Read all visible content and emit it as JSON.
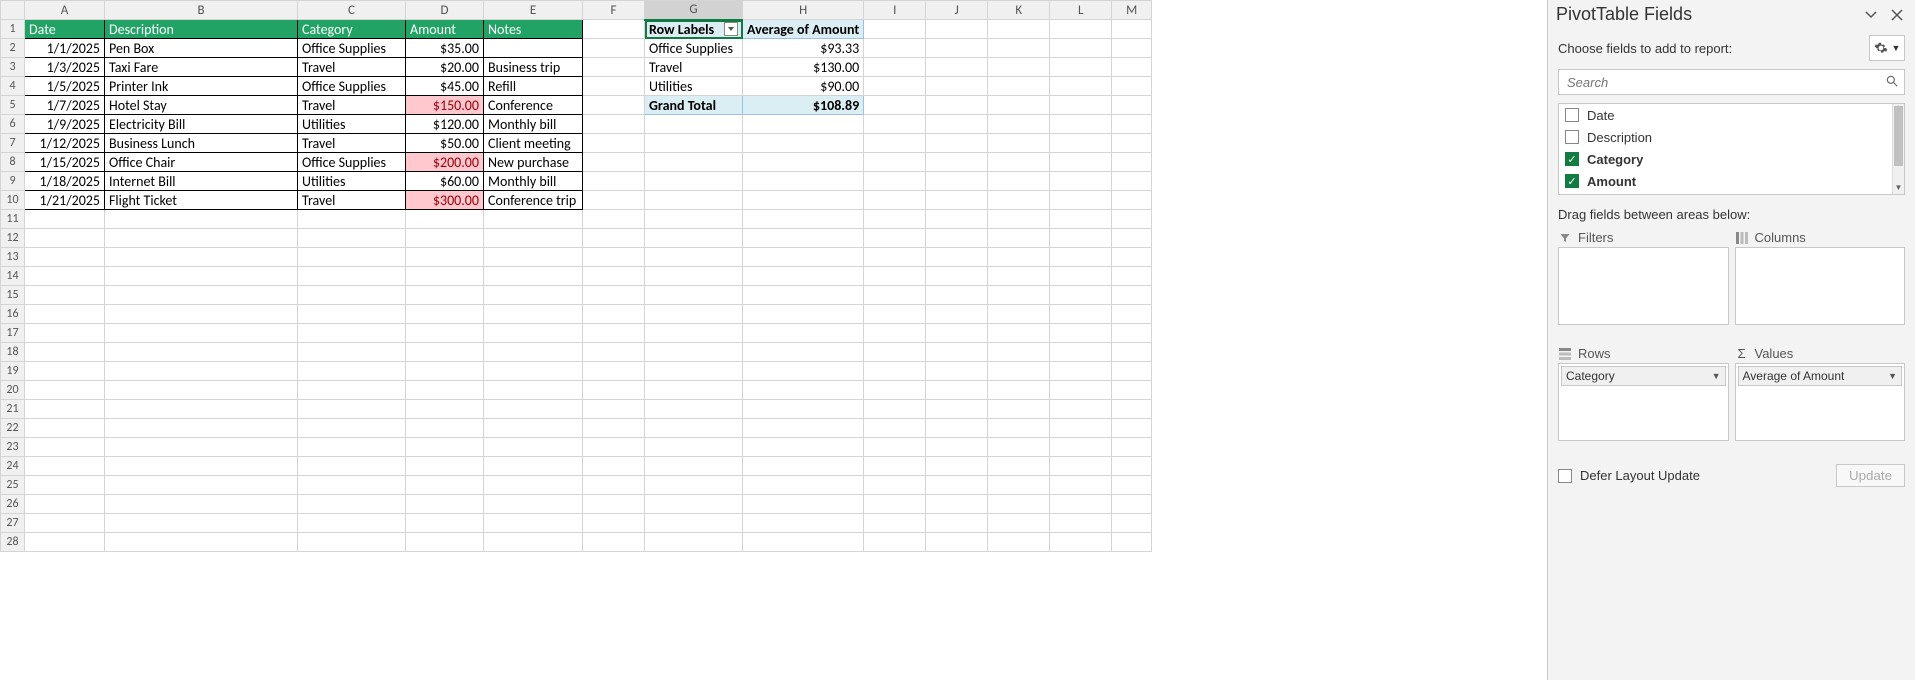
{
  "sheet": {
    "columns": [
      "A",
      "B",
      "C",
      "D",
      "E",
      "F",
      "G",
      "H",
      "I",
      "J",
      "K",
      "L",
      "M"
    ],
    "headers": {
      "A": "Date",
      "B": "Description",
      "C": "Category",
      "D": "Amount",
      "E": "Notes"
    },
    "rows": [
      {
        "A": "1/1/2025",
        "B": "Pen Box",
        "C": "Office Supplies",
        "D": "$35.00",
        "E": ""
      },
      {
        "A": "1/3/2025",
        "B": "Taxi Fare",
        "C": "Travel",
        "D": "$20.00",
        "E": "Business trip"
      },
      {
        "A": "1/5/2025",
        "B": "Printer Ink",
        "C": "Office Supplies",
        "D": "$45.00",
        "E": "Refill"
      },
      {
        "A": "1/7/2025",
        "B": "Hotel Stay",
        "C": "Travel",
        "D": "$150.00",
        "E": "Conference",
        "red": true
      },
      {
        "A": "1/9/2025",
        "B": "Electricity Bill",
        "C": "Utilities",
        "D": "$120.00",
        "E": "Monthly bill"
      },
      {
        "A": "1/12/2025",
        "B": "Business Lunch",
        "C": "Travel",
        "D": "$50.00",
        "E": "Client meeting"
      },
      {
        "A": "1/15/2025",
        "B": "Office Chair",
        "C": "Office Supplies",
        "D": "$200.00",
        "E": "New purchase",
        "red": true
      },
      {
        "A": "1/18/2025",
        "B": "Internet Bill",
        "C": "Utilities",
        "D": "$60.00",
        "E": "Monthly bill"
      },
      {
        "A": "1/21/2025",
        "B": "Flight Ticket",
        "C": "Travel",
        "D": "$300.00",
        "E": "Conference trip",
        "red": true
      }
    ],
    "pivot": {
      "header_left": "Row Labels",
      "header_right": "Average of Amount",
      "rows": [
        {
          "label": "Office Supplies",
          "value": "$93.33"
        },
        {
          "label": "Travel",
          "value": "$130.00"
        },
        {
          "label": "Utilities",
          "value": "$90.00"
        }
      ],
      "total_label": "Grand Total",
      "total_value": "$108.89"
    },
    "selected_col": "G"
  },
  "pane": {
    "title": "PivotTable Fields",
    "subtitle": "Choose fields to add to report:",
    "search_placeholder": "Search",
    "fields": [
      {
        "name": "Date",
        "checked": false
      },
      {
        "name": "Description",
        "checked": false
      },
      {
        "name": "Category",
        "checked": true
      },
      {
        "name": "Amount",
        "checked": true
      }
    ],
    "drag_label": "Drag fields between areas below:",
    "filters_label": "Filters",
    "columns_label": "Columns",
    "rows_label": "Rows",
    "values_label": "Values",
    "rows_chip": "Category",
    "values_chip": "Average of Amount",
    "defer_label": "Defer Layout Update",
    "update_label": "Update"
  }
}
